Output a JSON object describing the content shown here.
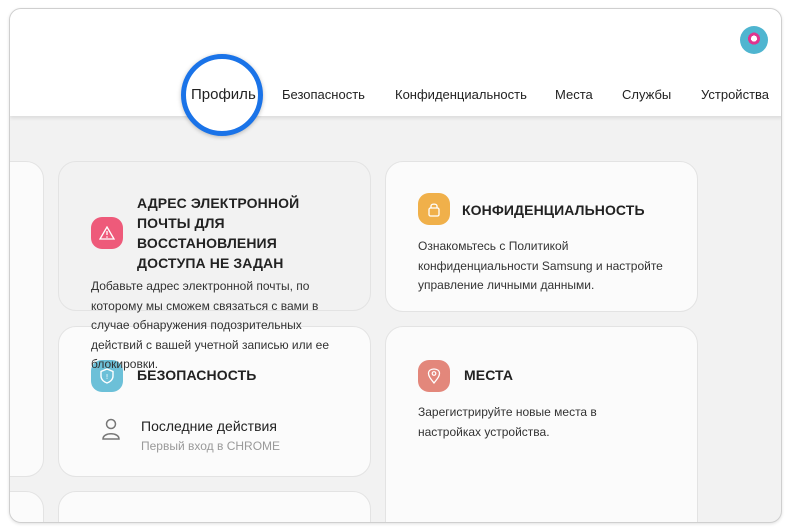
{
  "tabs": [
    {
      "label": "Профиль",
      "active": true
    },
    {
      "label": "Безопасность",
      "active": false
    },
    {
      "label": "Конфиденциальность",
      "active": false
    },
    {
      "label": "Места",
      "active": false
    },
    {
      "label": "Службы",
      "active": false
    },
    {
      "label": "Устройства",
      "active": false
    }
  ],
  "cards": {
    "recovery": {
      "title": "АДРЕС ЭЛЕКТРОННОЙ ПОЧТЫ ДЛЯ ВОССТАНОВЛЕНИЯ ДОСТУПА НЕ ЗАДАН",
      "text": "Добавьте адрес электронной почты, по которому мы сможем связаться с вами в случае обнаружения подозрительных действий с вашей учетной записью или ее блокировки.",
      "icon": "warning-icon",
      "color": "#ee5a7a"
    },
    "privacy": {
      "title": "КОНФИДЕНЦИАЛЬНОСТЬ",
      "text": "Ознакомьтесь с Политикой конфиденциальности Samsung и настройте управление личными данными.",
      "icon": "lock-icon",
      "color": "#f0b04a"
    },
    "security": {
      "title": "БЕЗОПАСНОСТЬ",
      "icon": "shield-icon",
      "color": "#6cc0d8",
      "item_title": "Последние действия",
      "item_subtitle": "Первый вход в CHROME"
    },
    "places": {
      "title": "МЕСТА",
      "text": "Зарегистрируйте новые места в настройках устройства.",
      "icon": "location-pin-icon",
      "color": "#e3877b"
    }
  }
}
